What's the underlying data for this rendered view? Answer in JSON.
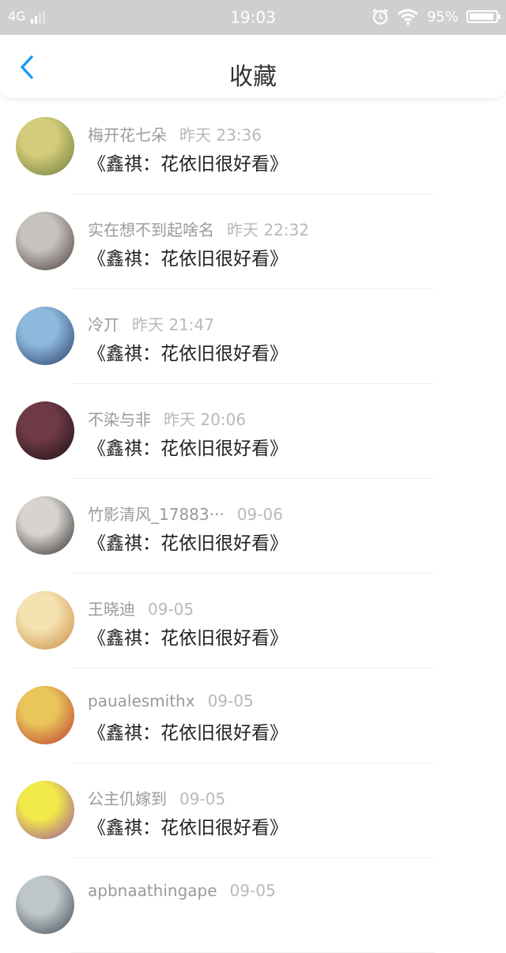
{
  "status": {
    "network": "4G",
    "time": "19:03",
    "battery_text": "95%",
    "battery_level": 0.95,
    "icons": [
      "alarm-icon",
      "wifi-icon",
      "battery-icon"
    ]
  },
  "nav": {
    "back_icon": "chevron-left-icon",
    "title": "收藏",
    "accent": "#1a9af5"
  },
  "items": [
    {
      "name": "梅开花七朵",
      "time": "昨天 23:36",
      "text": "《鑫祺：花依旧很好看》",
      "avatar_colors": [
        "#d4cc7a",
        "#6c7a3a"
      ]
    },
    {
      "name": "实在想不到起啥名",
      "time": "昨天 22:32",
      "text": "《鑫祺：花依旧很好看》",
      "avatar_colors": [
        "#c7c2bd",
        "#473b3a"
      ]
    },
    {
      "name": "冷丌",
      "time": "昨天 21:47",
      "text": "《鑫祺：花依旧很好看》",
      "avatar_colors": [
        "#8fb8dd",
        "#243b63"
      ]
    },
    {
      "name": "不染与非",
      "time": "昨天 20:06",
      "text": "《鑫祺：花依旧很好看》",
      "avatar_colors": [
        "#6e3a46",
        "#1a1012"
      ]
    },
    {
      "name": "竹影清风_17883···",
      "time": "09-06",
      "text": "《鑫祺：花依旧很好看》",
      "avatar_colors": [
        "#d7d3ce",
        "#2c2a2a"
      ]
    },
    {
      "name": "王晓迪",
      "time": "09-05",
      "text": "《鑫祺：花依旧很好看》",
      "avatar_colors": [
        "#f4e2b0",
        "#c98a3e"
      ]
    },
    {
      "name": "paualesmithx",
      "time": "09-05",
      "text": "《鑫祺：花依旧很好看》",
      "avatar_colors": [
        "#e9c55a",
        "#b9372e"
      ]
    },
    {
      "name": "公主仉嫁到",
      "time": "09-05",
      "text": "《鑫祺：花依旧很好看》",
      "avatar_colors": [
        "#f2ea49",
        "#9a4fa0"
      ]
    },
    {
      "name": "apbnaathingape",
      "time": "09-05",
      "text": "",
      "avatar_colors": [
        "#bfc6c9",
        "#3f4a52"
      ]
    }
  ]
}
